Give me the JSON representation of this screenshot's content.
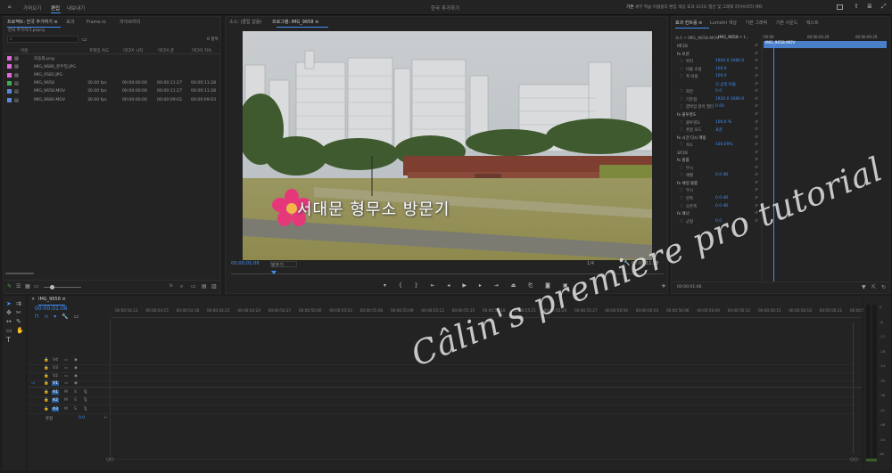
{
  "topbar": {
    "tabs": [
      "가져오기",
      "편집",
      "내보내기"
    ],
    "active_tab": "편집",
    "project_title": "한국 추가하기",
    "workspaces": [
      "기본",
      "세부",
      "학습",
      "어셈블리",
      "편집",
      "색상",
      "효과",
      "오디오",
      "캡션 및 그래픽",
      "라이브러리",
      "메타"
    ]
  },
  "project_panel": {
    "tabs": [
      "프로젝트: 한국 추가하기 ≡",
      "효과",
      "Frame.io",
      "라이브러리"
    ],
    "path": "한국 추가하기.prproj",
    "item_count": "6 항목",
    "columns": [
      "이름",
      "프레임 속도",
      "미디어 시작",
      "미디어 끝",
      "미디어 지속"
    ],
    "items": [
      {
        "name": "자승화.png",
        "fps": "",
        "start": "",
        "end": "",
        "dur": "",
        "color": "#e06ad8"
      },
      {
        "name": "IMG_9686_분주밀.JPG",
        "fps": "",
        "start": "",
        "end": "",
        "dur": "",
        "color": "#e06ad8"
      },
      {
        "name": "IMG_9582.JPG",
        "fps": "",
        "start": "",
        "end": "",
        "dur": "",
        "color": "#e06ad8"
      },
      {
        "name": "IMG_9658",
        "fps": "30.00 fps",
        "start": "00:00:00:00",
        "end": "00:00:11:27",
        "dur": "00:00:11:28",
        "color": "#3fae52"
      },
      {
        "name": "IMG_9658.MOV",
        "fps": "30.00 fps",
        "start": "00:00:00:00",
        "end": "00:00:11:27",
        "dur": "00:00:11:28",
        "color": "#5a88d8"
      },
      {
        "name": "IMG_9680.MOV",
        "fps": "30.00 fps",
        "start": "00:00:00:00",
        "end": "00:00:09:02",
        "dur": "00:00:09:03",
        "color": "#5a88d8"
      }
    ]
  },
  "program": {
    "tabs": [
      "소스: (클립 없음)",
      "프로그램: IMG_9658 ≡"
    ],
    "timecode": "00:00:01:06",
    "fit": "맞추기",
    "quality": "1/4",
    "duration": "00:00:11:28",
    "caption": "서대문 형무소 방문기"
  },
  "effect_controls": {
    "tabs": [
      "효과 컨트롤 ≡",
      "Lumetri 색상",
      "기본 그래픽",
      "기본 사운드",
      "텍스트"
    ],
    "source": "소스 • IMG_9658.MOV",
    "sequence": "IMG_9658 • I...",
    "mini_clip": "IMG_9658.MOV",
    "mini_start": "00:00",
    "mini_mid": "00:00:04:29",
    "mini_end": "00:00:09:29",
    "rows": [
      {
        "label": "비디오",
        "value": ""
      },
      {
        "label": "fx 모션",
        "value": ""
      },
      {
        "label": "위치",
        "value": "1920.0   1080.0"
      },
      {
        "label": "비율 조정",
        "value": "100.0"
      },
      {
        "label": "폭 비율",
        "value": "100.0"
      },
      {
        "label": "",
        "value": "☑ 균일 비율"
      },
      {
        "label": "회전",
        "value": "0.0"
      },
      {
        "label": "기준점",
        "value": "1920.0   1080.0"
      },
      {
        "label": "깜박임 방지 필터",
        "value": "0.00"
      },
      {
        "label": "fx 불투명도",
        "value": ""
      },
      {
        "label": "불투명도",
        "value": "100.0 %"
      },
      {
        "label": "혼합 모드",
        "value": "표준"
      },
      {
        "label": "fx 시간 다시 매핑",
        "value": ""
      },
      {
        "label": "속도",
        "value": "100.00%"
      },
      {
        "label": "오디오",
        "value": ""
      },
      {
        "label": "fx 볼륨",
        "value": ""
      },
      {
        "label": "무시",
        "value": ""
      },
      {
        "label": "레벨",
        "value": "0.0 dB"
      },
      {
        "label": "fx 채널 볼륨",
        "value": ""
      },
      {
        "label": "무시",
        "value": ""
      },
      {
        "label": "왼쪽",
        "value": "0.0 dB"
      },
      {
        "label": "오른쪽",
        "value": "0.0 dB"
      },
      {
        "label": "fx 패너",
        "value": ""
      },
      {
        "label": "균형",
        "value": "0.0"
      }
    ]
  },
  "timeline": {
    "sequence_name": "IMG_9658 ≡",
    "timecode": "00:00:01:06",
    "ruler": [
      "00:00:54:12",
      "00:00:54:15",
      "00:00:54:18",
      "00:00:54:21",
      "00:00:54:24",
      "00:00:54:27",
      "00:00:55:00",
      "00:00:55:03",
      "00:00:55:06",
      "00:00:55:09",
      "00:00:55:12",
      "00:00:55:15",
      "00:00:55:18",
      "00:00:55:21",
      "00:00:55:24",
      "00:00:55:27",
      "00:00:56:00",
      "00:00:56:03",
      "00:00:56:06",
      "00:00:56:09",
      "00:00:56:12",
      "00:00:56:15",
      "00:00:56:18",
      "00:00:56:21",
      "00:00:56:2"
    ],
    "video_tracks": [
      "V4",
      "V3",
      "V2",
      "V1"
    ],
    "audio_tracks": [
      "A1",
      "A2",
      "A3"
    ],
    "mix_label": "혼합",
    "mix_value": "0.0",
    "meter_labels": [
      "0",
      "-6",
      "-12",
      "-18",
      "-24",
      "-30",
      "-36",
      "-42",
      "-48",
      "-54",
      "dB"
    ]
  },
  "watermark": "Câlin's premiere pro tutorial"
}
